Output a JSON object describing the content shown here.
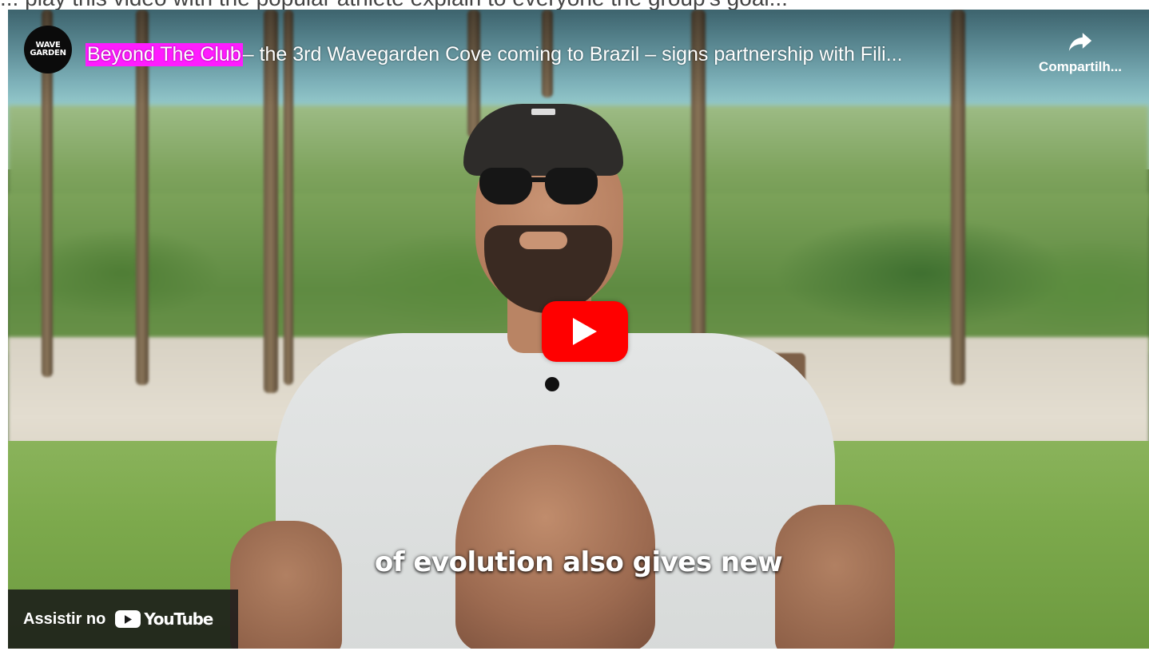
{
  "page": {
    "top_text": "... play this video with the popular athlete explain to everyone the group's goal..."
  },
  "channel": {
    "avatar_text": "WAVE GARDEN",
    "avatar_icon": "wavegarden-logo-icon"
  },
  "video": {
    "title_highlight": "Beyond The Club",
    "title_rest": " – the 3rd Wavegarden Cove coming to Brazil – signs partnership with Fili...",
    "caption": "of evolution also gives new"
  },
  "share": {
    "label": "Compartilh...",
    "icon": "share-arrow-icon"
  },
  "play": {
    "icon": "play-icon",
    "color": "#ff0000"
  },
  "watch_on": {
    "label": "Assistir no",
    "brand": "YouTube",
    "icon": "youtube-icon"
  },
  "colors": {
    "title_highlight": "#ff1cff",
    "watch_bar": "#171717"
  }
}
